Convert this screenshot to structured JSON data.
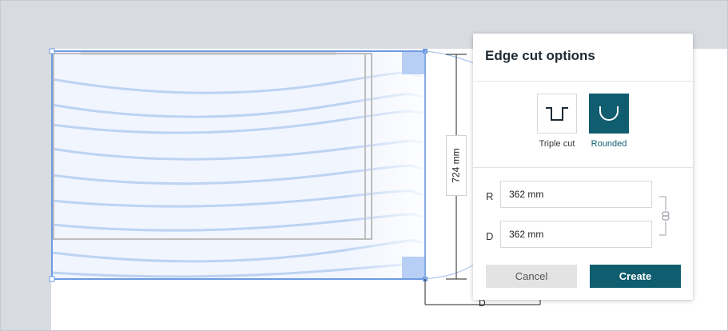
{
  "dimension": {
    "height_label": "724 mm",
    "depth_letter": "D"
  },
  "panel": {
    "title": "Edge cut options",
    "options": [
      {
        "label": "Triple cut",
        "icon": "triple-cut-icon",
        "selected": false
      },
      {
        "label": "Rounded",
        "icon": "rounded-cut-icon",
        "selected": true
      }
    ],
    "fields": [
      {
        "letter": "R",
        "value": "362 mm"
      },
      {
        "letter": "D",
        "value": "362 mm"
      }
    ],
    "link_icon": "chain-link-icon",
    "cancel_label": "Cancel",
    "create_label": "Create"
  },
  "colors": {
    "accent": "#0f5d6f",
    "selection": "#6d9be3",
    "background": "#d8dce1"
  }
}
